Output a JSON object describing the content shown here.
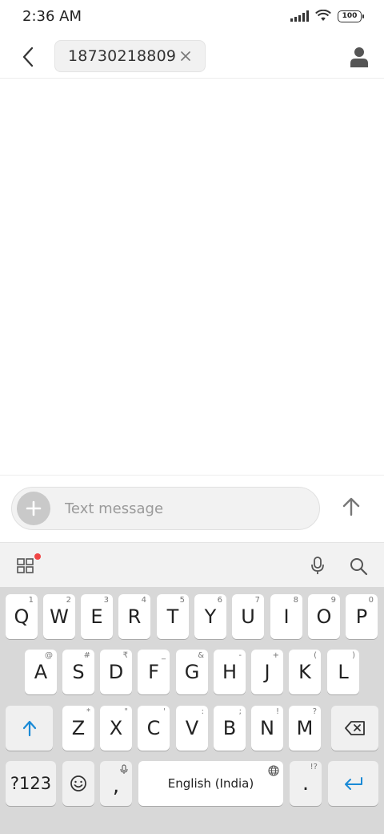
{
  "status_bar": {
    "time": "2:36 AM",
    "battery": "100"
  },
  "header": {
    "recipient": "18730218809",
    "icons": {
      "back": "chevron-left-icon",
      "close": "close-icon",
      "contact": "person-icon"
    }
  },
  "compose": {
    "placeholder": "Text message"
  },
  "keyboard": {
    "row1": [
      {
        "key": "Q",
        "hint": "1"
      },
      {
        "key": "W",
        "hint": "2"
      },
      {
        "key": "E",
        "hint": "3"
      },
      {
        "key": "R",
        "hint": "4"
      },
      {
        "key": "T",
        "hint": "5"
      },
      {
        "key": "Y",
        "hint": "6"
      },
      {
        "key": "U",
        "hint": "7"
      },
      {
        "key": "I",
        "hint": "8"
      },
      {
        "key": "O",
        "hint": "9"
      },
      {
        "key": "P",
        "hint": "0"
      }
    ],
    "row2": [
      {
        "key": "A",
        "hint": "@"
      },
      {
        "key": "S",
        "hint": "#"
      },
      {
        "key": "D",
        "hint": "₹"
      },
      {
        "key": "F",
        "hint": "_"
      },
      {
        "key": "G",
        "hint": "&"
      },
      {
        "key": "H",
        "hint": "-"
      },
      {
        "key": "J",
        "hint": "+"
      },
      {
        "key": "K",
        "hint": "("
      },
      {
        "key": "L",
        "hint": ")"
      }
    ],
    "row3": [
      {
        "key": "Z",
        "hint": "*"
      },
      {
        "key": "X",
        "hint": "\""
      },
      {
        "key": "C",
        "hint": "'"
      },
      {
        "key": "V",
        "hint": ":"
      },
      {
        "key": "B",
        "hint": ";"
      },
      {
        "key": "N",
        "hint": "!"
      },
      {
        "key": "M",
        "hint": "?"
      }
    ],
    "symbols_label": "?123",
    "comma": ",",
    "period": ".",
    "period_hint": "!?",
    "space_label": "English (India)",
    "accent_color": "#1a8ad6"
  }
}
